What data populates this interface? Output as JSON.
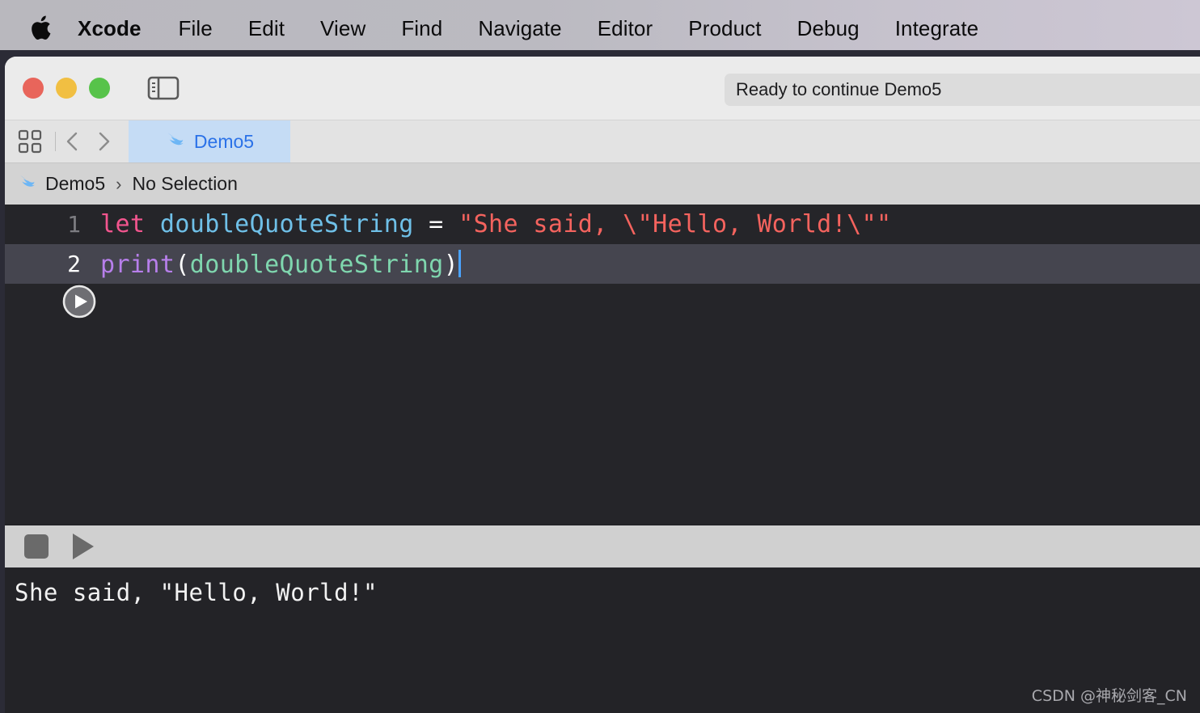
{
  "menubar": {
    "apple_icon": "apple-logo-icon",
    "items": [
      {
        "label": "Xcode",
        "bold": true
      },
      {
        "label": "File",
        "bold": false
      },
      {
        "label": "Edit",
        "bold": false
      },
      {
        "label": "View",
        "bold": false
      },
      {
        "label": "Find",
        "bold": false
      },
      {
        "label": "Navigate",
        "bold": false
      },
      {
        "label": "Editor",
        "bold": false
      },
      {
        "label": "Product",
        "bold": false
      },
      {
        "label": "Debug",
        "bold": false
      },
      {
        "label": "Integrate",
        "bold": false
      }
    ]
  },
  "window": {
    "traffic_lights": {
      "close_color": "#e8655b",
      "minimize_color": "#f1bf42",
      "maximize_color": "#57c34a"
    },
    "sidebar_toggle_icon": "sidebar-toggle-icon",
    "status": "Ready to continue Demo5"
  },
  "tabbar": {
    "grid_icon": "tab-grid-icon",
    "back_icon": "chevron-left-icon",
    "forward_icon": "chevron-right-icon",
    "tabs": [
      {
        "label": "Demo5",
        "icon": "swift-bird-icon",
        "active": true
      }
    ]
  },
  "breadcrumb": {
    "file_icon": "swift-bird-icon",
    "file": "Demo5",
    "separator": "›",
    "selection": "No Selection"
  },
  "editor": {
    "run_icon": "playground-run-icon",
    "lines": [
      {
        "number": "1",
        "active": false,
        "tokens": [
          {
            "text": "let",
            "type": "keyword"
          },
          {
            "text": " ",
            "type": "plain"
          },
          {
            "text": "doubleQuoteString",
            "type": "ident"
          },
          {
            "text": " = ",
            "type": "plain"
          },
          {
            "text": "\"She said, \\\"Hello, World!\\\"\"",
            "type": "string"
          }
        ]
      },
      {
        "number": "2",
        "active": true,
        "tokens": [
          {
            "text": "print",
            "type": "func"
          },
          {
            "text": "(",
            "type": "plain"
          },
          {
            "text": "doubleQuoteString",
            "type": "var"
          },
          {
            "text": ")",
            "type": "plain"
          }
        ]
      }
    ],
    "colors": {
      "background": "#252529",
      "active_line_background": "#45454f",
      "keyword": "#f2558e",
      "identifier": "#6fc0e8",
      "string": "#f4635e",
      "function": "#b77feb",
      "variable": "#7fd6ae",
      "plain": "#ffffff",
      "caret": "#4aa3ff"
    }
  },
  "debug_bar": {
    "stop_icon": "stop-square-icon",
    "run_icon": "play-triangle-icon"
  },
  "console": {
    "output_lines": [
      "She said, \"Hello, World!\""
    ]
  },
  "watermark": "CSDN @神秘剑客_CN"
}
